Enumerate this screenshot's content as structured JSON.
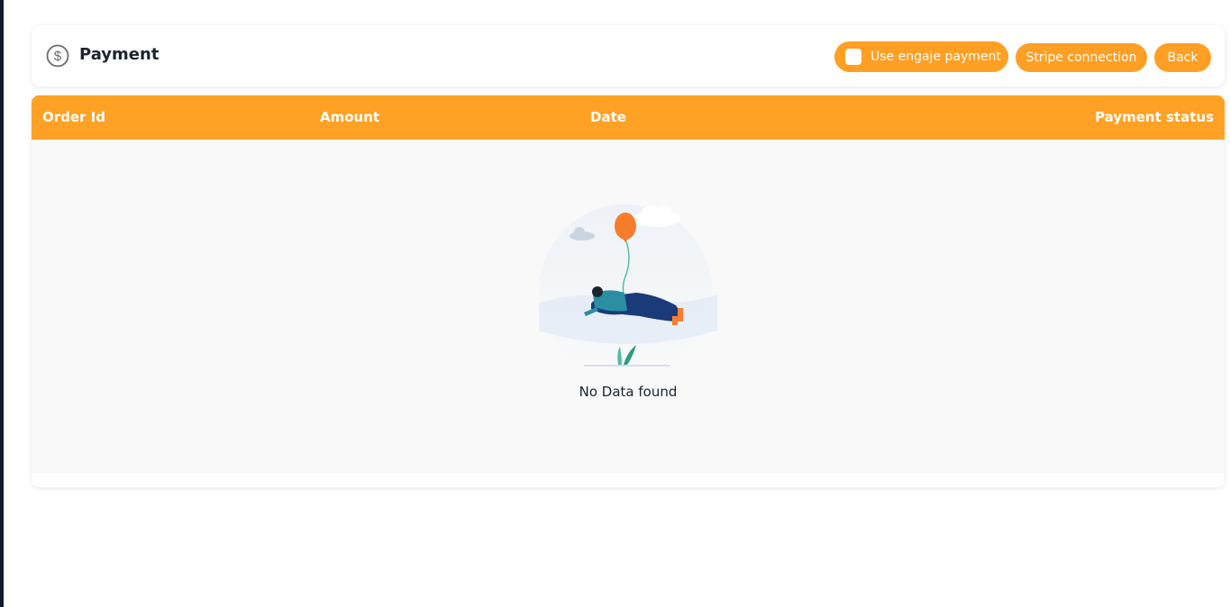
{
  "page": {
    "title": "Payment",
    "title_icon": "dollar-circle-icon"
  },
  "actions": {
    "use_engaje_payment": {
      "label": "Use engaje payment",
      "checked": false
    },
    "stripe_connection": "Stripe connection",
    "back": "Back"
  },
  "table": {
    "columns": [
      "Order Id",
      "Amount",
      "Date",
      "Payment status"
    ],
    "rows": [],
    "empty_message": "No Data found",
    "empty_icon": "balloon-person-illustration"
  },
  "colors": {
    "accent": "#ffa124",
    "table_body": "#f9f9f9",
    "text_dark": "#1b2430"
  }
}
